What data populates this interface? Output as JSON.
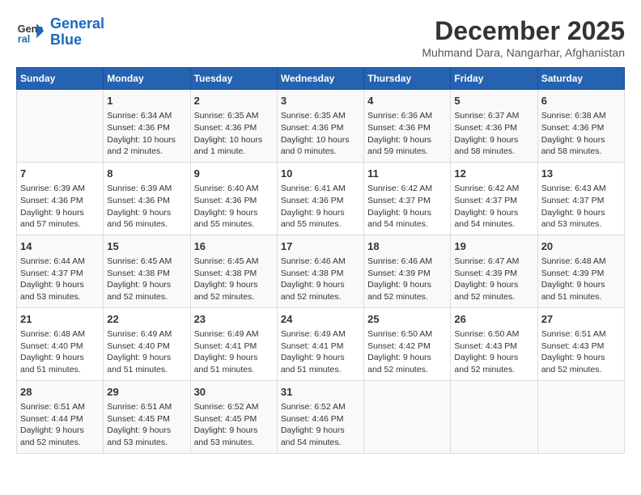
{
  "header": {
    "logo_line1": "General",
    "logo_line2": "Blue",
    "month_title": "December 2025",
    "subtitle": "Muhmand Dara, Nangarhar, Afghanistan"
  },
  "days_of_week": [
    "Sunday",
    "Monday",
    "Tuesday",
    "Wednesday",
    "Thursday",
    "Friday",
    "Saturday"
  ],
  "weeks": [
    [
      {
        "day": "",
        "info": ""
      },
      {
        "day": "1",
        "info": "Sunrise: 6:34 AM\nSunset: 4:36 PM\nDaylight: 10 hours\nand 2 minutes."
      },
      {
        "day": "2",
        "info": "Sunrise: 6:35 AM\nSunset: 4:36 PM\nDaylight: 10 hours\nand 1 minute."
      },
      {
        "day": "3",
        "info": "Sunrise: 6:35 AM\nSunset: 4:36 PM\nDaylight: 10 hours\nand 0 minutes."
      },
      {
        "day": "4",
        "info": "Sunrise: 6:36 AM\nSunset: 4:36 PM\nDaylight: 9 hours\nand 59 minutes."
      },
      {
        "day": "5",
        "info": "Sunrise: 6:37 AM\nSunset: 4:36 PM\nDaylight: 9 hours\nand 58 minutes."
      },
      {
        "day": "6",
        "info": "Sunrise: 6:38 AM\nSunset: 4:36 PM\nDaylight: 9 hours\nand 58 minutes."
      }
    ],
    [
      {
        "day": "7",
        "info": "Sunrise: 6:39 AM\nSunset: 4:36 PM\nDaylight: 9 hours\nand 57 minutes."
      },
      {
        "day": "8",
        "info": "Sunrise: 6:39 AM\nSunset: 4:36 PM\nDaylight: 9 hours\nand 56 minutes."
      },
      {
        "day": "9",
        "info": "Sunrise: 6:40 AM\nSunset: 4:36 PM\nDaylight: 9 hours\nand 55 minutes."
      },
      {
        "day": "10",
        "info": "Sunrise: 6:41 AM\nSunset: 4:36 PM\nDaylight: 9 hours\nand 55 minutes."
      },
      {
        "day": "11",
        "info": "Sunrise: 6:42 AM\nSunset: 4:37 PM\nDaylight: 9 hours\nand 54 minutes."
      },
      {
        "day": "12",
        "info": "Sunrise: 6:42 AM\nSunset: 4:37 PM\nDaylight: 9 hours\nand 54 minutes."
      },
      {
        "day": "13",
        "info": "Sunrise: 6:43 AM\nSunset: 4:37 PM\nDaylight: 9 hours\nand 53 minutes."
      }
    ],
    [
      {
        "day": "14",
        "info": "Sunrise: 6:44 AM\nSunset: 4:37 PM\nDaylight: 9 hours\nand 53 minutes."
      },
      {
        "day": "15",
        "info": "Sunrise: 6:45 AM\nSunset: 4:38 PM\nDaylight: 9 hours\nand 52 minutes."
      },
      {
        "day": "16",
        "info": "Sunrise: 6:45 AM\nSunset: 4:38 PM\nDaylight: 9 hours\nand 52 minutes."
      },
      {
        "day": "17",
        "info": "Sunrise: 6:46 AM\nSunset: 4:38 PM\nDaylight: 9 hours\nand 52 minutes."
      },
      {
        "day": "18",
        "info": "Sunrise: 6:46 AM\nSunset: 4:39 PM\nDaylight: 9 hours\nand 52 minutes."
      },
      {
        "day": "19",
        "info": "Sunrise: 6:47 AM\nSunset: 4:39 PM\nDaylight: 9 hours\nand 52 minutes."
      },
      {
        "day": "20",
        "info": "Sunrise: 6:48 AM\nSunset: 4:39 PM\nDaylight: 9 hours\nand 51 minutes."
      }
    ],
    [
      {
        "day": "21",
        "info": "Sunrise: 6:48 AM\nSunset: 4:40 PM\nDaylight: 9 hours\nand 51 minutes."
      },
      {
        "day": "22",
        "info": "Sunrise: 6:49 AM\nSunset: 4:40 PM\nDaylight: 9 hours\nand 51 minutes."
      },
      {
        "day": "23",
        "info": "Sunrise: 6:49 AM\nSunset: 4:41 PM\nDaylight: 9 hours\nand 51 minutes."
      },
      {
        "day": "24",
        "info": "Sunrise: 6:49 AM\nSunset: 4:41 PM\nDaylight: 9 hours\nand 51 minutes."
      },
      {
        "day": "25",
        "info": "Sunrise: 6:50 AM\nSunset: 4:42 PM\nDaylight: 9 hours\nand 52 minutes."
      },
      {
        "day": "26",
        "info": "Sunrise: 6:50 AM\nSunset: 4:43 PM\nDaylight: 9 hours\nand 52 minutes."
      },
      {
        "day": "27",
        "info": "Sunrise: 6:51 AM\nSunset: 4:43 PM\nDaylight: 9 hours\nand 52 minutes."
      }
    ],
    [
      {
        "day": "28",
        "info": "Sunrise: 6:51 AM\nSunset: 4:44 PM\nDaylight: 9 hours\nand 52 minutes."
      },
      {
        "day": "29",
        "info": "Sunrise: 6:51 AM\nSunset: 4:45 PM\nDaylight: 9 hours\nand 53 minutes."
      },
      {
        "day": "30",
        "info": "Sunrise: 6:52 AM\nSunset: 4:45 PM\nDaylight: 9 hours\nand 53 minutes."
      },
      {
        "day": "31",
        "info": "Sunrise: 6:52 AM\nSunset: 4:46 PM\nDaylight: 9 hours\nand 54 minutes."
      },
      {
        "day": "",
        "info": ""
      },
      {
        "day": "",
        "info": ""
      },
      {
        "day": "",
        "info": ""
      }
    ]
  ]
}
